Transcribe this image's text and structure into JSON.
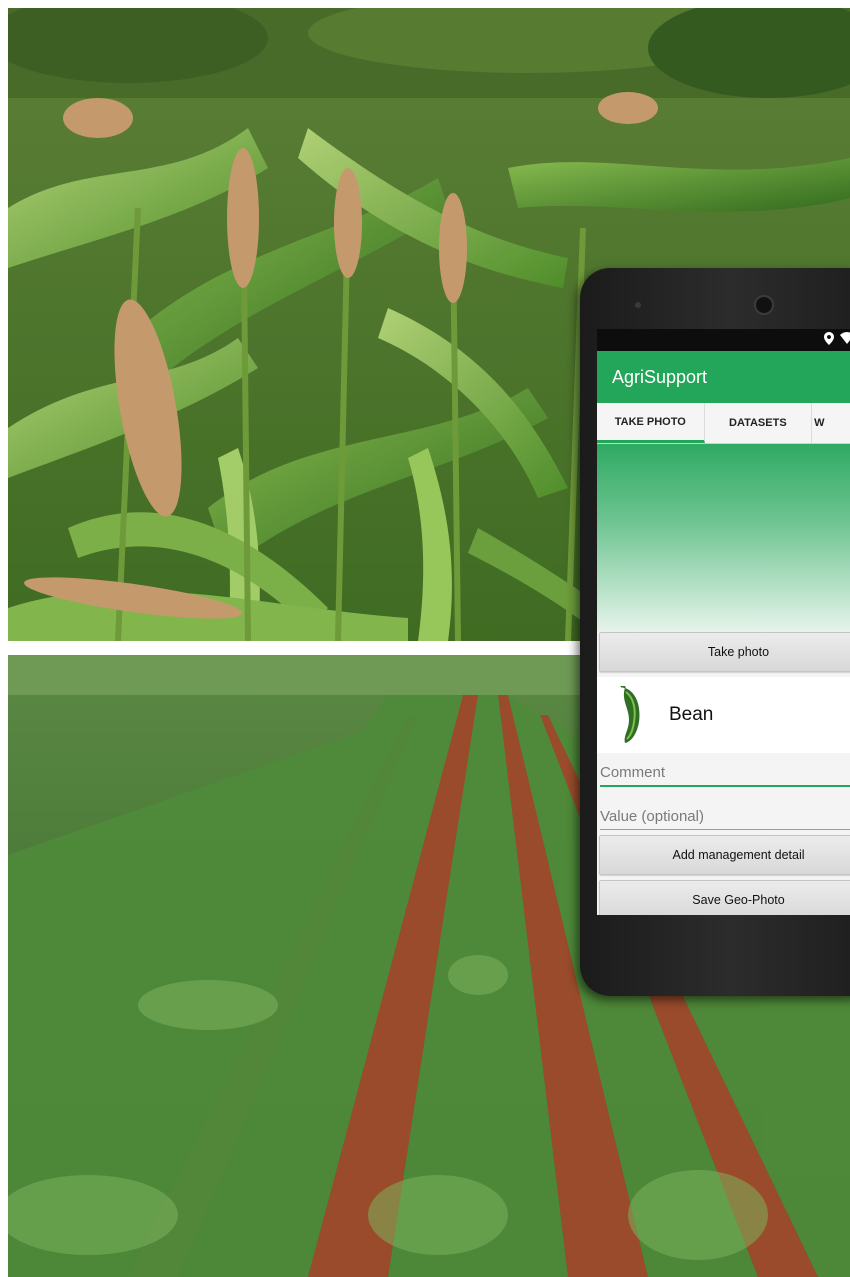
{
  "app": {
    "title": "AgriSupport",
    "accent_color": "#23a659"
  },
  "status_bar": {
    "icons": [
      "location-icon",
      "wifi-icon"
    ]
  },
  "tabs": [
    {
      "label": "TAKE PHOTO",
      "selected": true
    },
    {
      "label": "DATASETS",
      "selected": false
    },
    {
      "label": "W",
      "selected": false
    }
  ],
  "buttons": {
    "take_photo": "Take photo",
    "add_management_detail": "Add management detail",
    "save_geo_photo": "Save Geo-Photo"
  },
  "crop": {
    "name": "Bean",
    "icon": "bean-pod-icon"
  },
  "fields": {
    "comment_placeholder": "Comment",
    "value_placeholder": "Value (optional)"
  },
  "background_photos": [
    "maize-field-photo",
    "bean-field-photo"
  ]
}
